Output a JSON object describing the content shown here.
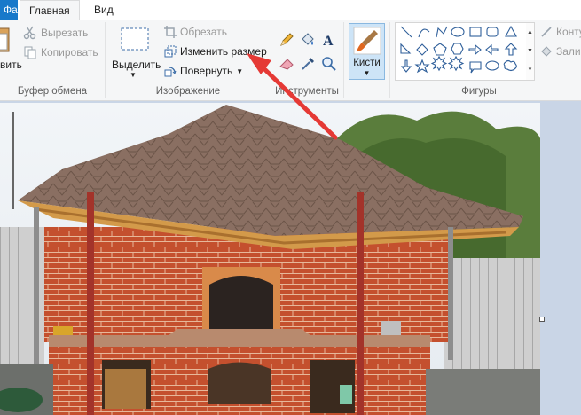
{
  "tabs": {
    "file": "Фа",
    "home": "Главная",
    "view": "Вид"
  },
  "clipboard": {
    "paste": "вить",
    "cut": "Вырезать",
    "copy": "Копировать",
    "group": "Буфер обмена"
  },
  "image": {
    "select": "Выделить",
    "crop": "Обрезать",
    "resize": "Изменить размер",
    "rotate": "Повернуть",
    "group": "Изображение"
  },
  "tools": {
    "group": "Инструменты"
  },
  "brushes": {
    "label": "Кисти"
  },
  "shapes": {
    "group": "Фигуры",
    "outline": "Конту",
    "fill": "Зали"
  },
  "colors": {
    "accent": "#1979ca",
    "arrow": "#e53935",
    "brick": "#c4502e",
    "roof": "#8a6f62"
  },
  "icons": [
    "paste-icon",
    "scissors-icon",
    "copy-icon",
    "select-icon",
    "crop-icon",
    "resize-icon",
    "rotate-icon",
    "pencil-icon",
    "fill-icon",
    "text-icon",
    "eraser-icon",
    "color-picker-icon",
    "magnifier-icon",
    "brush-icon"
  ]
}
